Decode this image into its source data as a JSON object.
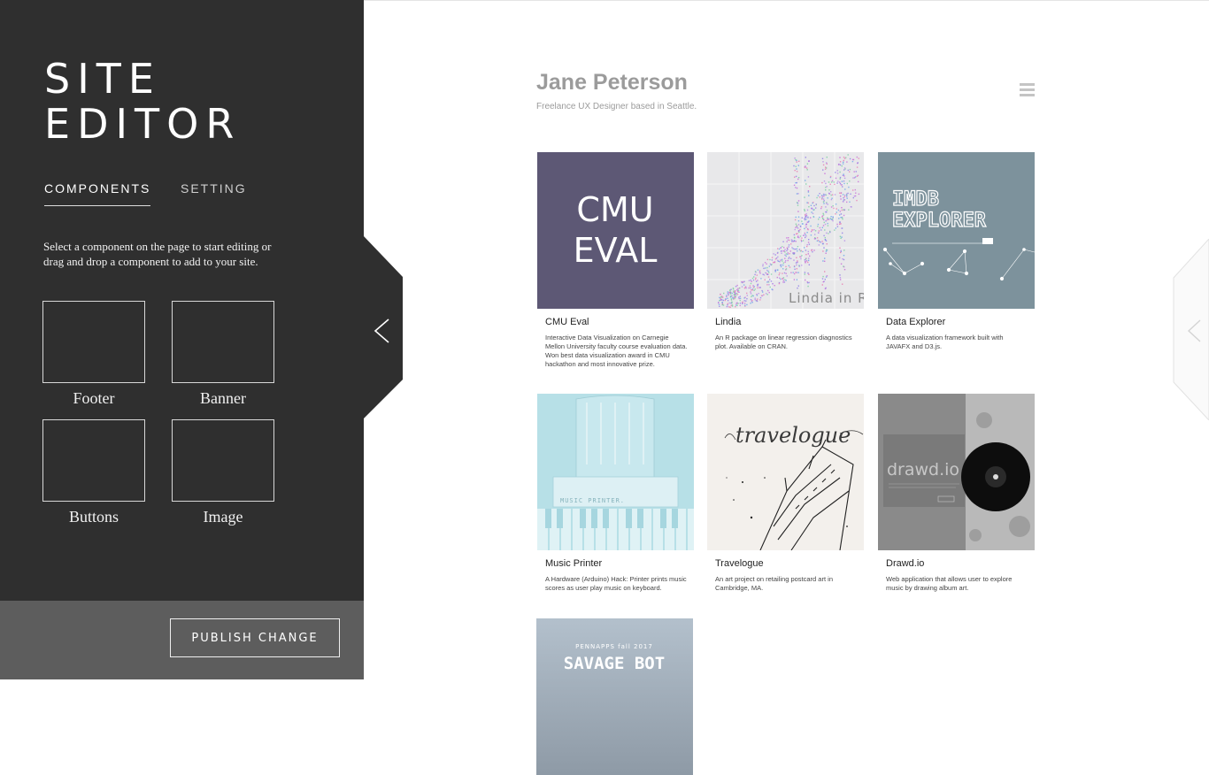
{
  "sidebar": {
    "title_line1": "SITE",
    "title_line2": "EDITOR",
    "tabs": [
      {
        "label": "COMPONENTS",
        "active": true
      },
      {
        "label": "SETTING",
        "active": false
      }
    ],
    "description": "Select a component on the page to start editing or drag and drop a component to add to your site.",
    "components": [
      {
        "label": "Footer"
      },
      {
        "label": "Banner"
      },
      {
        "label": "Buttons"
      },
      {
        "label": "Image"
      }
    ],
    "publish_label": "PUBLISH CHANGE",
    "collapse_icon": "chevron-left-icon"
  },
  "site": {
    "name": "Jane Peterson",
    "subtitle": "Freelance UX Designer based in Seattle.",
    "menu_icon": "hamburger-menu-icon",
    "projects": [
      {
        "title": "CMU Eval",
        "description": "Interactive Data Visualization on Carnegie Mellon University faculty course evaluation data. Won best data visualization award in CMU hackathon and most innovative prize.",
        "thumb_text": [
          "CMU",
          "EVAL"
        ]
      },
      {
        "title": "Lindia",
        "description": "An R package on linear regression diagnostics plot. Available on CRAN.",
        "thumb_text": [
          "Lindia in R"
        ]
      },
      {
        "title": "Data Explorer",
        "description": "A data visualization framework built with JAVAFX and D3.js.",
        "thumb_text": [
          "IMDB",
          "EXPLORER"
        ]
      },
      {
        "title": "Music Printer",
        "description": "A Hardware (Arduino) Hack: Printer prints music scores as user play music on keyboard.",
        "thumb_text": [
          "MUSIC PRINTER."
        ]
      },
      {
        "title": "Travelogue",
        "description": "An art project on retailing postcard art in Cambridge, MA.",
        "thumb_text": [
          "travelogue"
        ]
      },
      {
        "title": "Drawd.io",
        "description": "Web application that allows user to explore music by drawing album art.",
        "thumb_text": [
          "drawd.io"
        ]
      },
      {
        "title": "",
        "description": "",
        "thumb_text": [
          "PENNAPPS fall 2017",
          "SAVAGE BOT"
        ]
      }
    ]
  },
  "colors": {
    "sidebar_bg": "#2f2f2f",
    "sidebar_bottom_bg": "#5d5d5d",
    "text_gray": "#9b9b9b",
    "cmu_bg": "#5d5875",
    "imdb_bg": "#7d929c",
    "music_bg": "#b7e0e7",
    "savage_bg": "#aab6c2"
  }
}
